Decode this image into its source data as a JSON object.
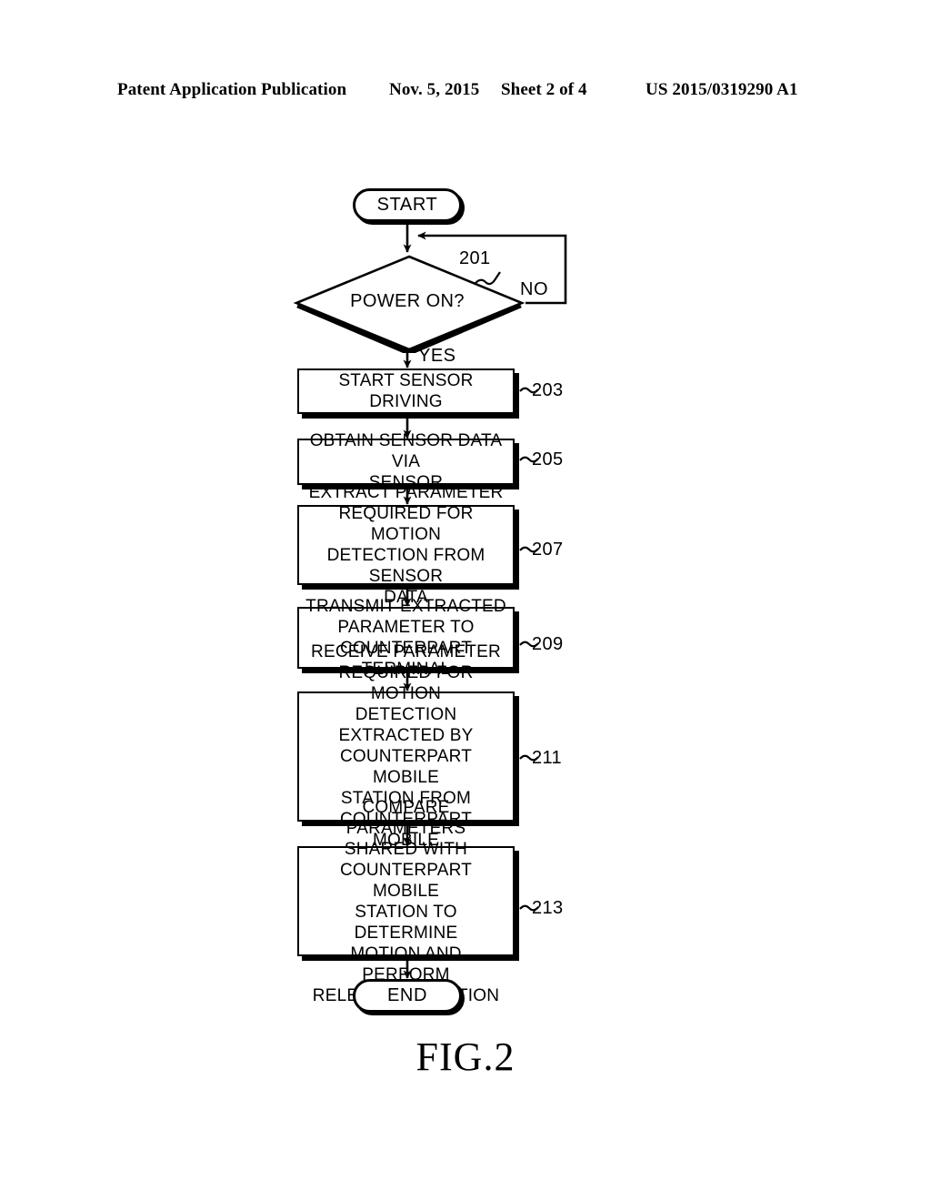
{
  "header": {
    "publication": "Patent Application Publication",
    "date": "Nov. 5, 2015",
    "sheet": "Sheet 2 of 4",
    "publication_number": "US 2015/0319290 A1"
  },
  "figure": {
    "caption": "FIG.2",
    "start_label": "START",
    "end_label": "END",
    "decision": {
      "text": "POWER ON?",
      "ref": "201",
      "yes_label": "YES",
      "no_label": "NO"
    },
    "steps": [
      {
        "ref": "203",
        "text": "START SENSOR DRIVING"
      },
      {
        "ref": "205",
        "text": "OBTAIN SENSOR DATA VIA\nSENSOR"
      },
      {
        "ref": "207",
        "text": "EXTRACT PARAMETER\nREQUIRED FOR MOTION\nDETECTION FROM SENSOR\nDATA"
      },
      {
        "ref": "209",
        "text": "TRANSMIT EXTRACTED\nPARAMETER TO\nCOUNTERPART TERMINAL"
      },
      {
        "ref": "211",
        "text": "RECEIVE PARAMETER\nREQUIRED FOR MOTION\nDETECTION EXTRACTED BY\nCOUNTERPART MOBILE\nSTATION FROM\nCOUNTERPART MOBILE\nSTATION"
      },
      {
        "ref": "213",
        "text": "COMPARE PARAMETERS\nSHARED WITH\nCOUNTERPART MOBILE\nSTATION TO DETERMINE\nMOTION AND PERFORM\nRELEVANT FUNCTION"
      }
    ]
  },
  "colors": {
    "ink": "#000000",
    "paper": "#ffffff"
  }
}
